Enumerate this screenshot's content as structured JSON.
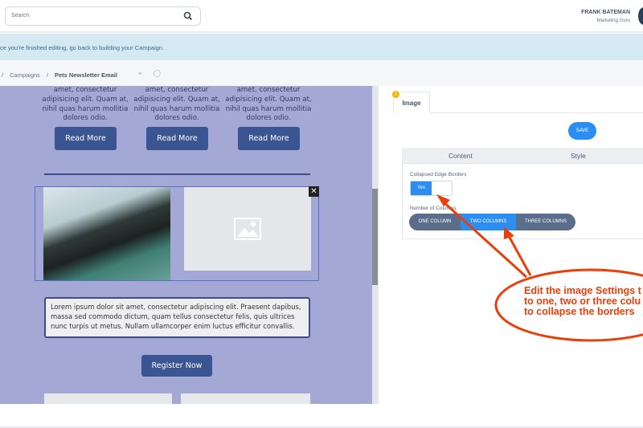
{
  "header": {
    "search_placeholder": "Search",
    "user_name": "FRANK BATEMAN",
    "user_role": "Marketing Guru"
  },
  "info_bar": {
    "text": "ce you're finished editing, go back to building your Campaign."
  },
  "breadcrumb": {
    "items": [
      "/",
      "Campaigns",
      "/",
      "Pets Newsletter Email"
    ]
  },
  "email": {
    "columns": [
      {
        "text": "amet, consectetur adipisicing elit. Quam at, nihil quas harum mollitia dolores odio.",
        "button": "Read More"
      },
      {
        "text": "amet, consectetur adipisicing elit. Quam at, nihil quas harum mollitia dolores odio.",
        "button": "Read More"
      },
      {
        "text": "amet, consectetur adipisicing elit. Quam at, nihil quas harum mollitia dolores odio.",
        "button": "Read More"
      }
    ],
    "close_label": "✕",
    "body_text": "Lorem ipsum dolor sit amet, consectetur adipiscing elit. Praesent dapibus, massa sed commodo dictum, quam tellus consectetur felis, quis ultrices nunc turpis ut metus. Nullam ullamcorper enim luctus efficitur convallis.",
    "register_button": "Register Now"
  },
  "panel": {
    "tab": "Image",
    "warning": "!",
    "save": "SAVE",
    "subtabs": [
      "Content",
      "Style"
    ],
    "collapsed_label": "Collapsed Edge Borders",
    "toggle_value": "Yes",
    "columns_label": "Number of Columns",
    "column_options": [
      "ONE COLUMN",
      "TWO COLUMNS",
      "THREE COLUMNS"
    ],
    "selected_option": "TWO COLUMNS"
  },
  "annotation": {
    "text": "Edit the image Settings t\nto one, two or three colu\nto collapse the borders",
    "color": "#e8400c"
  },
  "colors": {
    "accent": "#2b8ef0",
    "email_button": "#3b5592",
    "canvas_bg": "#a3a9d4"
  }
}
